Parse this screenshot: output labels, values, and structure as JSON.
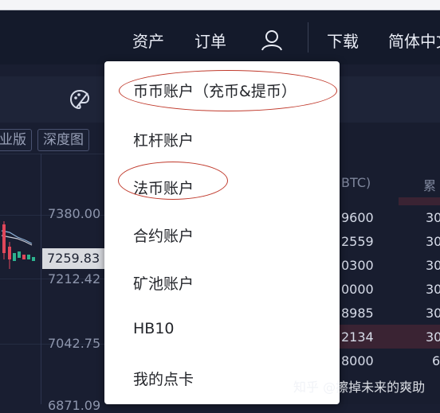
{
  "nav": {
    "assets": "资产",
    "orders": "订单",
    "download": "下载",
    "language": "简体中文"
  },
  "chart_controls": {
    "pro_label": "业版",
    "depth_label": "深度图"
  },
  "price_axis": {
    "p1": "7380.00",
    "current": "7259.83",
    "p2": "7212.42",
    "p3": "7042.75",
    "p4": "6871.09"
  },
  "orderbook": {
    "header_amount": "BTC)",
    "header_total": "累",
    "rows": [
      {
        "amount": "9600",
        "total": "30"
      },
      {
        "amount": "2559",
        "total": "30"
      },
      {
        "amount": "0300",
        "total": "30"
      },
      {
        "amount": "0000",
        "total": "30"
      },
      {
        "amount": "8985",
        "total": "30"
      },
      {
        "amount": "2134",
        "total": "30"
      },
      {
        "amount": "8000",
        "total": "6"
      }
    ]
  },
  "menu": {
    "items": [
      "币币账户（充币&提币）",
      "杠杆账户",
      "法币账户",
      "合约账户",
      "矿池账户",
      "HB10",
      "我的点卡"
    ]
  },
  "watermark": "知乎 @擦掉未来的爽助",
  "colors": {
    "background": "#191e31",
    "menu_bg": "#ffffff",
    "annotation": "#c0392b",
    "up": "#2db38f",
    "down": "#e0475a"
  }
}
